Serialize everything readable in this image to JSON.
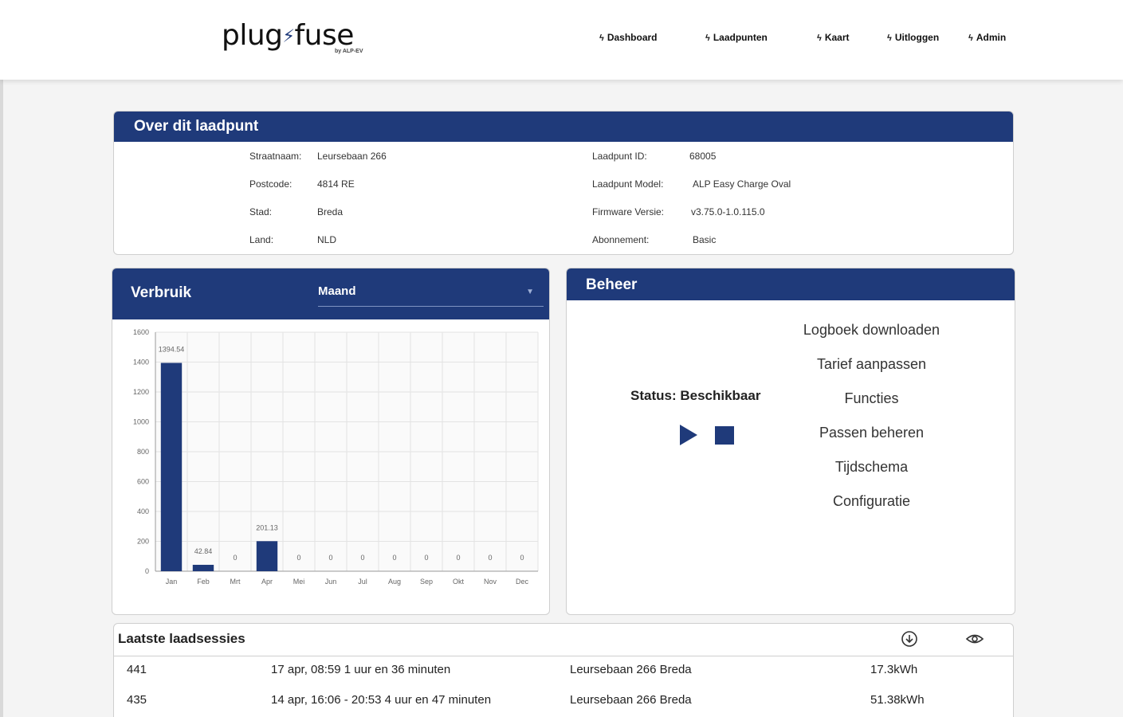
{
  "brand": {
    "logo_left": "plug",
    "logo_right": "fuse",
    "logo_sub": "by ALP-EV"
  },
  "nav": [
    {
      "label": "Dashboard"
    },
    {
      "label": "Laadpunten"
    },
    {
      "label": "Kaart"
    },
    {
      "label": "Uitloggen"
    },
    {
      "label": "Admin"
    }
  ],
  "about": {
    "title": "Over dit laadpunt",
    "left": [
      {
        "label": "Straatnaam:",
        "value": "Leursebaan 266"
      },
      {
        "label": "Postcode:",
        "value": "4814 RE"
      },
      {
        "label": "Stad:",
        "value": "Breda"
      },
      {
        "label": "Land:",
        "value": "NLD"
      }
    ],
    "right": [
      {
        "label": "Laadpunt ID:",
        "value": "68005"
      },
      {
        "label": "Laadpunt Model:",
        "value": "ALP Easy Charge Oval"
      },
      {
        "label": "Firmware Versie:",
        "value": "v3.75.0-1.0.115.0"
      },
      {
        "label": "Abonnement:",
        "value": "Basic"
      }
    ]
  },
  "usage": {
    "title": "Verbruik",
    "period": "Maand"
  },
  "chart_data": {
    "type": "bar",
    "categories": [
      "Jan",
      "Feb",
      "Mrt",
      "Apr",
      "Mei",
      "Jun",
      "Jul",
      "Aug",
      "Sep",
      "Okt",
      "Nov",
      "Dec"
    ],
    "values": [
      1394.54,
      42.84,
      0,
      201.13,
      0,
      0,
      0,
      0,
      0,
      0,
      0,
      0
    ],
    "data_labels": [
      "1394.54",
      "42.84",
      "0",
      "201.13",
      "0",
      "0",
      "0",
      "0",
      "0",
      "0",
      "0",
      "0"
    ],
    "y_ticks": [
      "0",
      "200",
      "400",
      "600",
      "800",
      "1000",
      "1200",
      "1400",
      "1600"
    ],
    "ylim": [
      0,
      1600
    ],
    "grid": true,
    "bar_color": "#1f3a7a"
  },
  "beheer": {
    "title": "Beheer",
    "status": "Status: Beschikbaar",
    "actions": [
      {
        "label": "Logboek downloaden"
      },
      {
        "label": "Tarief aanpassen"
      },
      {
        "label": "Functies"
      },
      {
        "label": "Passen beheren"
      },
      {
        "label": "Tijdschema"
      },
      {
        "label": "Configuratie"
      }
    ]
  },
  "sessions": {
    "title": "Laatste laadsessies",
    "rows": [
      {
        "id": "441",
        "time": "17 apr, 08:59 1 uur en 36 minuten",
        "location": "Leursebaan 266 Breda",
        "energy": "17.3kWh"
      },
      {
        "id": "435",
        "time": "14 apr, 16:06 - 20:53 4 uur en 47 minuten",
        "location": "Leursebaan 266 Breda",
        "energy": "51.38kWh"
      }
    ]
  },
  "colors": {
    "primary": "#1f3a7a",
    "background": "#f4f4f4"
  }
}
